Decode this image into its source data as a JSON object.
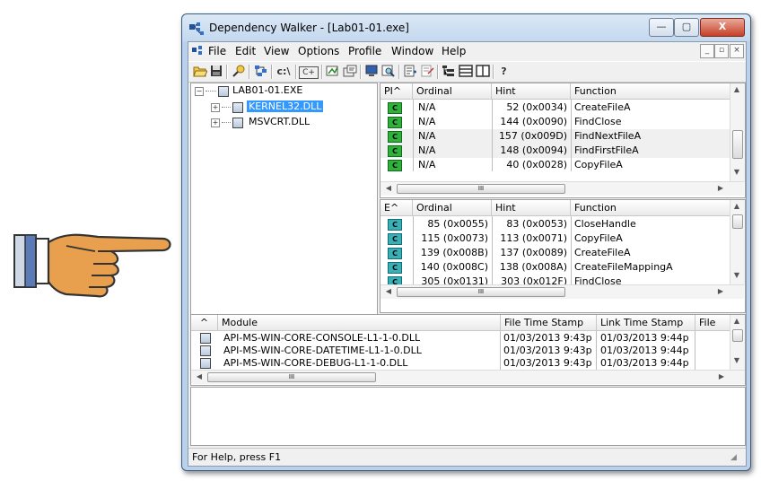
{
  "window": {
    "title": "Dependency Walker - [Lab01-01.exe]",
    "controls": {
      "minimize": "—",
      "maximize": "▢",
      "close": "X"
    }
  },
  "menubar": {
    "items": [
      "File",
      "Edit",
      "View",
      "Options",
      "Profile",
      "Window",
      "Help"
    ],
    "mdi": {
      "minimize": "_",
      "restore": "▫",
      "close": "×"
    }
  },
  "toolbar": {
    "icons": [
      "open-icon",
      "save-icon",
      "view-full-paths-icon",
      "undecorate-icon",
      "path-icon",
      "cplusplus-icon",
      "configure-icon",
      "properties-icon",
      "system-info-icon",
      "find-icon",
      "expand-all-icon",
      "collapse-all-icon",
      "tree-view-icon",
      "list-view-icon",
      "split-view-icon",
      "help-icon"
    ],
    "labels": {
      "path": "c:\\",
      "cpp": "C+",
      "help": "?"
    }
  },
  "tree": {
    "root": "LAB01-01.EXE",
    "children": [
      {
        "label": "KERNEL32.DLL",
        "selected": true
      },
      {
        "label": "MSVCRT.DLL",
        "selected": false
      }
    ]
  },
  "imports": {
    "headers": [
      "PI^",
      "Ordinal",
      "Hint",
      "Function"
    ],
    "rows": [
      {
        "ordinal": "N/A",
        "hint": "52 (0x0034)",
        "function": "CreateFileA"
      },
      {
        "ordinal": "N/A",
        "hint": "144 (0x0090)",
        "function": "FindClose"
      },
      {
        "ordinal": "N/A",
        "hint": "157 (0x009D)",
        "function": "FindNextFileA"
      },
      {
        "ordinal": "N/A",
        "hint": "148 (0x0094)",
        "function": "FindFirstFileA"
      },
      {
        "ordinal": "N/A",
        "hint": "40 (0x0028)",
        "function": "CopyFileA"
      }
    ],
    "badge": "C",
    "hscroll_label": "III"
  },
  "exports": {
    "headers": [
      "E^",
      "Ordinal",
      "Hint",
      "Function"
    ],
    "rows": [
      {
        "ordinal": "85 (0x0055)",
        "hint": "83 (0x0053)",
        "function": "CloseHandle"
      },
      {
        "ordinal": "115 (0x0073)",
        "hint": "113 (0x0071)",
        "function": "CopyFileA"
      },
      {
        "ordinal": "139 (0x008B)",
        "hint": "137 (0x0089)",
        "function": "CreateFileA"
      },
      {
        "ordinal": "140 (0x008C)",
        "hint": "138 (0x008A)",
        "function": "CreateFileMappingA"
      },
      {
        "ordinal": "305 (0x0131)",
        "hint": "303 (0x012F)",
        "function": "FindClose"
      }
    ],
    "badge": "C",
    "hscroll_label": "III"
  },
  "modules": {
    "headers": [
      "^",
      "Module",
      "File Time Stamp",
      "Link Time Stamp",
      "File"
    ],
    "rows": [
      {
        "module": "API-MS-WIN-CORE-CONSOLE-L1-1-0.DLL",
        "file_ts": "01/03/2013  9:43p",
        "link_ts": "01/03/2013  9:44p"
      },
      {
        "module": "API-MS-WIN-CORE-DATETIME-L1-1-0.DLL",
        "file_ts": "01/03/2013  9:43p",
        "link_ts": "01/03/2013  9:44p"
      },
      {
        "module": "API-MS-WIN-CORE-DEBUG-L1-1-0.DLL",
        "file_ts": "01/03/2013  9:43p",
        "link_ts": "01/03/2013  9:44p"
      }
    ],
    "hscroll_label": "III"
  },
  "status": {
    "text": "For Help, press F1"
  }
}
